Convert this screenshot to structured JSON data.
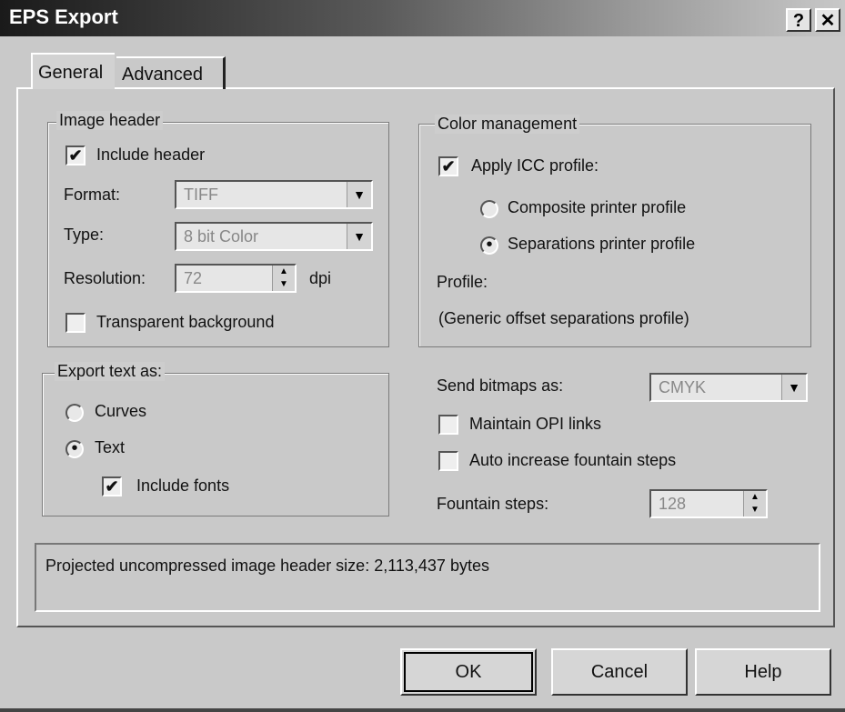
{
  "window": {
    "title": "EPS Export",
    "help_btn": "?",
    "close_btn": "✕"
  },
  "tabs": [
    "General",
    "Advanced"
  ],
  "image_header": {
    "legend": "Image header",
    "include_header": "Include header",
    "format_label": "Format:",
    "format_value": "TIFF",
    "type_label": "Type:",
    "type_value": "8 bit Color",
    "resolution_label": "Resolution:",
    "resolution_value": "72",
    "resolution_unit": "dpi",
    "transparent_bg": "Transparent background"
  },
  "color_management": {
    "legend": "Color management",
    "apply_icc": "Apply ICC profile:",
    "composite": "Composite printer profile",
    "separations": "Separations printer profile",
    "profile_label": "Profile:",
    "profile_value": "(Generic offset separations profile)"
  },
  "export_text": {
    "legend": "Export text as:",
    "curves": "Curves",
    "text": "Text",
    "include_fonts": "Include fonts"
  },
  "bitmaps": {
    "send_label": "Send bitmaps as:",
    "send_value": "CMYK",
    "maintain_opi": "Maintain OPI links",
    "auto_increase": "Auto increase fountain steps",
    "fountain_label": "Fountain steps:",
    "fountain_value": "128"
  },
  "status": "Projected uncompressed image header size: 2,113,437 bytes",
  "buttons": {
    "ok": "OK",
    "cancel": "Cancel",
    "help": "Help"
  }
}
